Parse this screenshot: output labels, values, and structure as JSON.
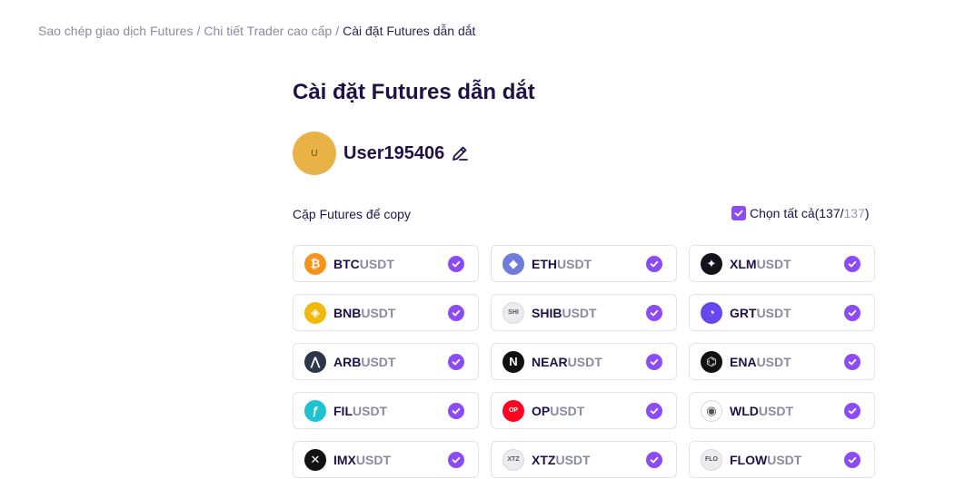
{
  "breadcrumb": {
    "items": [
      "Sao chép giao dịch Futures",
      "Chi tiết Trader cao cấp"
    ],
    "current": "Cài đặt Futures dẫn dắt",
    "separator": "/"
  },
  "page": {
    "title": "Cài đặt Futures dẫn dắt"
  },
  "user": {
    "avatar_text": "U",
    "name": "User195406",
    "avatar_color": "#e8b246"
  },
  "pairs_section": {
    "label": "Cặp Futures để copy",
    "select_all": {
      "label": "Chọn tất cả(137/",
      "total": "137",
      "close": ")",
      "checked": true
    },
    "pairs": [
      {
        "base": "BTC",
        "quote": "USDT",
        "icon": "btc-icon",
        "icon_text": "₿",
        "color": "#f7931a",
        "checked": true
      },
      {
        "base": "ETH",
        "quote": "USDT",
        "icon": "eth-icon",
        "icon_text": "◆",
        "color": "#6f7cd9",
        "checked": true
      },
      {
        "base": "XLM",
        "quote": "USDT",
        "icon": "xlm-icon",
        "icon_text": "✦",
        "color": "#14121a",
        "checked": true
      },
      {
        "base": "BNB",
        "quote": "USDT",
        "icon": "bnb-icon",
        "icon_text": "◈",
        "color": "#f0b90b",
        "checked": true
      },
      {
        "base": "SHIB",
        "quote": "USDT",
        "icon": "shib-icon",
        "icon_text": "SHI",
        "color": "#ececf0",
        "checked": true
      },
      {
        "base": "GRT",
        "quote": "USDT",
        "icon": "grt-icon",
        "icon_text": "◔",
        "color": "#6747ed",
        "checked": true
      },
      {
        "base": "ARB",
        "quote": "USDT",
        "icon": "arb-icon",
        "icon_text": "⋀",
        "color": "#2d374b",
        "checked": true
      },
      {
        "base": "NEAR",
        "quote": "USDT",
        "icon": "near-icon",
        "icon_text": "N",
        "color": "#111111",
        "checked": true
      },
      {
        "base": "ENA",
        "quote": "USDT",
        "icon": "ena-icon",
        "icon_text": "⌬",
        "color": "#111111",
        "checked": true
      },
      {
        "base": "FIL",
        "quote": "USDT",
        "icon": "fil-icon",
        "icon_text": "ƒ",
        "color": "#1fc2d0",
        "checked": true
      },
      {
        "base": "OP",
        "quote": "USDT",
        "icon": "op-icon",
        "icon_text": "OP",
        "color": "#ff0420",
        "checked": true
      },
      {
        "base": "WLD",
        "quote": "USDT",
        "icon": "wld-icon",
        "icon_text": "◉",
        "color": "#ffffff",
        "checked": true
      },
      {
        "base": "IMX",
        "quote": "USDT",
        "icon": "imx-icon",
        "icon_text": "✕",
        "color": "#111111",
        "checked": true
      },
      {
        "base": "XTZ",
        "quote": "USDT",
        "icon": "xtz-icon",
        "icon_text": "XTZ",
        "color": "#ececf0",
        "checked": true
      },
      {
        "base": "FLOW",
        "quote": "USDT",
        "icon": "flow-icon",
        "icon_text": "FLO",
        "color": "#ececf0",
        "checked": true
      }
    ]
  },
  "colors": {
    "accent": "#8b4cf5",
    "title": "#1f1248",
    "muted": "#8a8aa0"
  }
}
